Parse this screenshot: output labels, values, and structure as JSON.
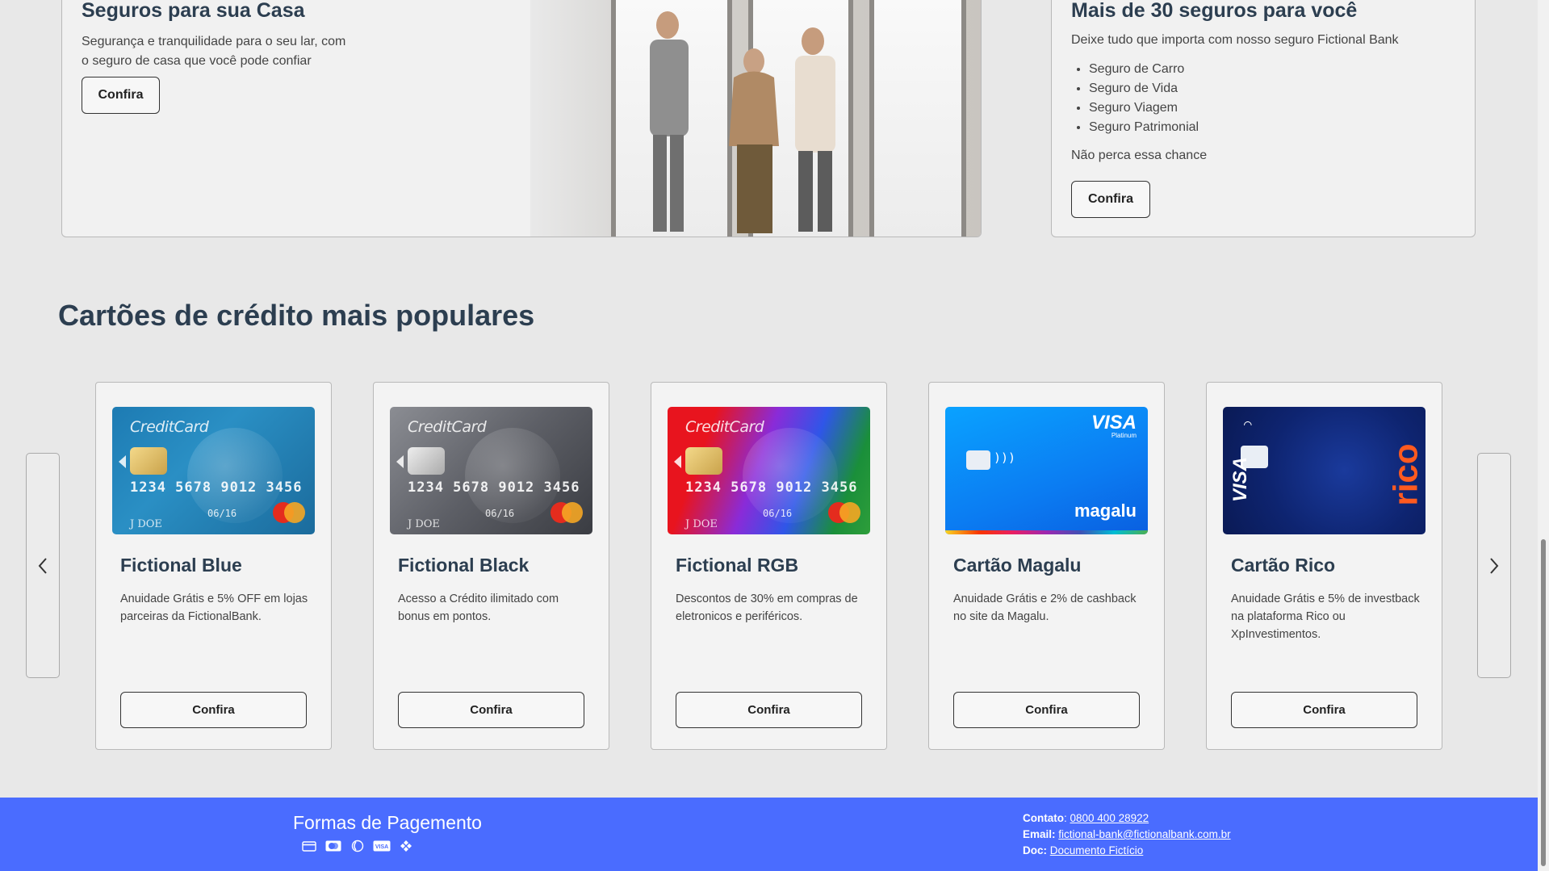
{
  "insurance_home": {
    "title": "Seguros para sua Casa",
    "description": "Segurança e tranquilidade para o seu lar, com o seguro de casa que você pode confiar",
    "button": "Confira"
  },
  "insurance_list": {
    "title": "Mais de 30 seguros para você",
    "description": "Deixe tudo que importa com nosso seguro Fictional Bank",
    "items": [
      "Seguro de Carro",
      "Seguro de Vida",
      "Seguro Viagem",
      "Seguro Patrimonial"
    ],
    "note": "Não perca essa chance",
    "button": "Confira"
  },
  "cards_section": {
    "title": "Cartões de crédito mais populares",
    "cards": [
      {
        "name": "Fictional Blue",
        "description": "Anuidade Grátis e 5% OFF em lojas parceiras da FictionalBank.",
        "button": "Confira"
      },
      {
        "name": "Fictional Black",
        "description": "Acesso a Crédito ilimitado com bonus em pontos.",
        "button": "Confira"
      },
      {
        "name": "Fictional RGB",
        "description": "Descontos de 30% em compras de eletronicos e periféricos.",
        "button": "Confira"
      },
      {
        "name": "Cartão Magalu",
        "description": "Anuidade Grátis e 2% de cashback no site da Magalu.",
        "button": "Confira"
      },
      {
        "name": "Cartão Rico",
        "description": "Anuidade Grátis e 5% de investback na plataforma Rico ou XpInvestimentos.",
        "button": "Confira"
      }
    ],
    "card_art": {
      "brand": "CreditCard",
      "number": "1234 5678 9012 3456",
      "expiry": "06/16",
      "holder": "J DOE",
      "magalu_visa": "VISA",
      "magalu_platinum": "Platinum",
      "magalu_logo": "magalu",
      "rico_visa": "VISA",
      "rico_logo": "rico"
    }
  },
  "footer": {
    "payment_title": "Formas de Pagemento",
    "payment_icons": [
      "credit-card-icon",
      "mastercard-icon",
      "diners-icon",
      "visa-icon",
      "pix-icon"
    ],
    "contact_label": "Contato",
    "contact_value": "0800 400 28922",
    "email_label": "Email:",
    "email_value": "fictional-bank@fictionalbank.com.br",
    "doc_label": "Doc:",
    "doc_value": "Documento Fictício"
  },
  "colors": {
    "footer_bg": "#4a6cff",
    "title": "#2c3e50",
    "page_bg": "#e8e8e8"
  }
}
